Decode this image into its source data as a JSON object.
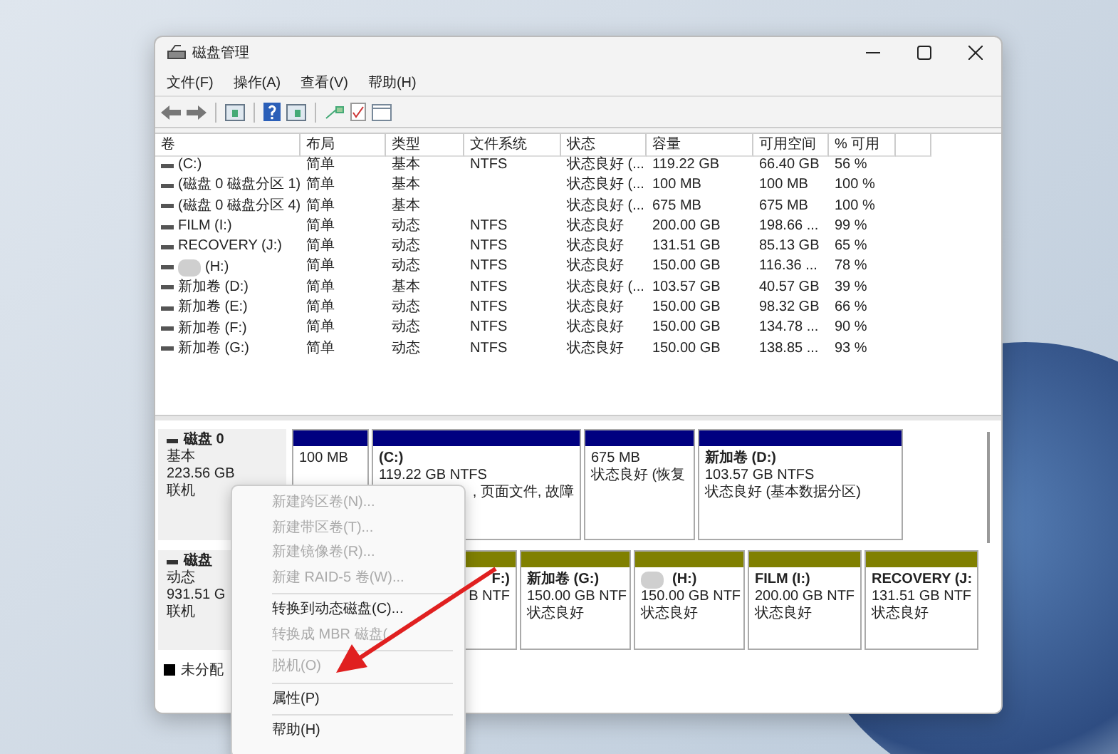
{
  "window": {
    "title": "磁盘管理"
  },
  "menu": [
    "文件(F)",
    "操作(A)",
    "查看(V)",
    "帮助(H)"
  ],
  "table": {
    "columns": [
      "卷",
      "布局",
      "类型",
      "文件系统",
      "状态",
      "容量",
      "可用空间",
      "% 可用"
    ],
    "rows": [
      {
        "redacted": false,
        "cells": [
          "(C:)",
          "简单",
          "基本",
          "NTFS",
          "状态良好 (...",
          "119.22 GB",
          "66.40 GB",
          "56 %"
        ]
      },
      {
        "redacted": false,
        "cells": [
          "(磁盘 0 磁盘分区 1)",
          "简单",
          "基本",
          "",
          "状态良好 (...",
          "100 MB",
          "100 MB",
          "100 %"
        ]
      },
      {
        "redacted": false,
        "cells": [
          "(磁盘 0 磁盘分区 4)",
          "简单",
          "基本",
          "",
          "状态良好 (...",
          "675 MB",
          "675 MB",
          "100 %"
        ]
      },
      {
        "redacted": false,
        "cells": [
          "FILM (I:)",
          "简单",
          "动态",
          "NTFS",
          "状态良好",
          "200.00 GB",
          "198.66 ...",
          "99 %"
        ]
      },
      {
        "redacted": false,
        "cells": [
          "RECOVERY (J:)",
          "简单",
          "动态",
          "NTFS",
          "状态良好",
          "131.51 GB",
          "85.13 GB",
          "65 %"
        ]
      },
      {
        "redacted": true,
        "cells": [
          "(H:)",
          "简单",
          "动态",
          "NTFS",
          "状态良好",
          "150.00 GB",
          "116.36 ...",
          "78 %"
        ]
      },
      {
        "redacted": false,
        "cells": [
          "新加卷 (D:)",
          "简单",
          "基本",
          "NTFS",
          "状态良好 (...",
          "103.57 GB",
          "40.57 GB",
          "39 %"
        ]
      },
      {
        "redacted": false,
        "cells": [
          "新加卷 (E:)",
          "简单",
          "动态",
          "NTFS",
          "状态良好",
          "150.00 GB",
          "98.32 GB",
          "66 %"
        ]
      },
      {
        "redacted": false,
        "cells": [
          "新加卷 (F:)",
          "简单",
          "动态",
          "NTFS",
          "状态良好",
          "150.00 GB",
          "134.78 ...",
          "90 %"
        ]
      },
      {
        "redacted": false,
        "cells": [
          "新加卷 (G:)",
          "简单",
          "动态",
          "NTFS",
          "状态良好",
          "150.00 GB",
          "138.85 ...",
          "93 %"
        ]
      }
    ]
  },
  "disks": [
    {
      "name": "磁盘 0",
      "type": "基本",
      "size": "223.56 GB",
      "status": "联机",
      "color": "#000080",
      "partitions": [
        {
          "redacted": false,
          "clipped": false,
          "lines": [
            "100 MB"
          ]
        },
        {
          "label": "(C:)",
          "redacted": false,
          "clipped": false,
          "lines": [
            "119.22 GB NTFS"
          ]
        },
        {
          "redacted": false,
          "clipped": false,
          "lines": [
            "675 MB",
            "状态良好 (恢复"
          ]
        },
        {
          "label": "新加卷 (D:)",
          "redacted": false,
          "clipped": false,
          "lines": [
            "103.57 GB NTFS",
            "状态良好 (基本数据分区)"
          ]
        }
      ]
    },
    {
      "name": "磁盘",
      "type": "动态",
      "size": "931.51 G",
      "status": "联机",
      "color": "#808000",
      "partitions": [
        {
          "label": "F:)",
          "redacted": false,
          "clipped": true,
          "lines": [
            "B NTF"
          ]
        },
        {
          "label": "新加卷 (G:)",
          "redacted": false,
          "clipped": false,
          "lines": [
            "150.00 GB NTF",
            "状态良好"
          ]
        },
        {
          "label": "(H:)",
          "redacted": true,
          "clipped": false,
          "lines": [
            "150.00 GB NTF",
            "状态良好"
          ]
        },
        {
          "label": "FILM (I:)",
          "redacted": false,
          "clipped": false,
          "lines": [
            "200.00 GB NTF",
            "状态良好"
          ]
        },
        {
          "label": "RECOVERY (J:",
          "redacted": false,
          "clipped": false,
          "lines": [
            "131.51 GB NTF",
            "状态良好"
          ]
        }
      ]
    }
  ],
  "c_note": ", 页面文件, 故障",
  "legend": [
    "未分配"
  ],
  "context_menu": [
    {
      "kind": "item",
      "label": "新建跨区卷(N)...",
      "disabled": true
    },
    {
      "kind": "item",
      "label": "新建带区卷(T)...",
      "disabled": true
    },
    {
      "kind": "item",
      "label": "新建镜像卷(R)...",
      "disabled": true
    },
    {
      "kind": "item",
      "label": "新建 RAID-5 卷(W)...",
      "disabled": true
    },
    {
      "kind": "separator"
    },
    {
      "kind": "item",
      "label": "转换到动态磁盘(C)...",
      "disabled": false
    },
    {
      "kind": "item",
      "label": "转换成 MBR 磁盘(",
      "disabled": true
    },
    {
      "kind": "separator"
    },
    {
      "kind": "item",
      "label": "脱机(O)",
      "disabled": true
    },
    {
      "kind": "separator"
    },
    {
      "kind": "item",
      "label": "属性(P)",
      "disabled": false
    },
    {
      "kind": "separator"
    },
    {
      "kind": "item",
      "label": "帮助(H)",
      "disabled": false
    }
  ]
}
